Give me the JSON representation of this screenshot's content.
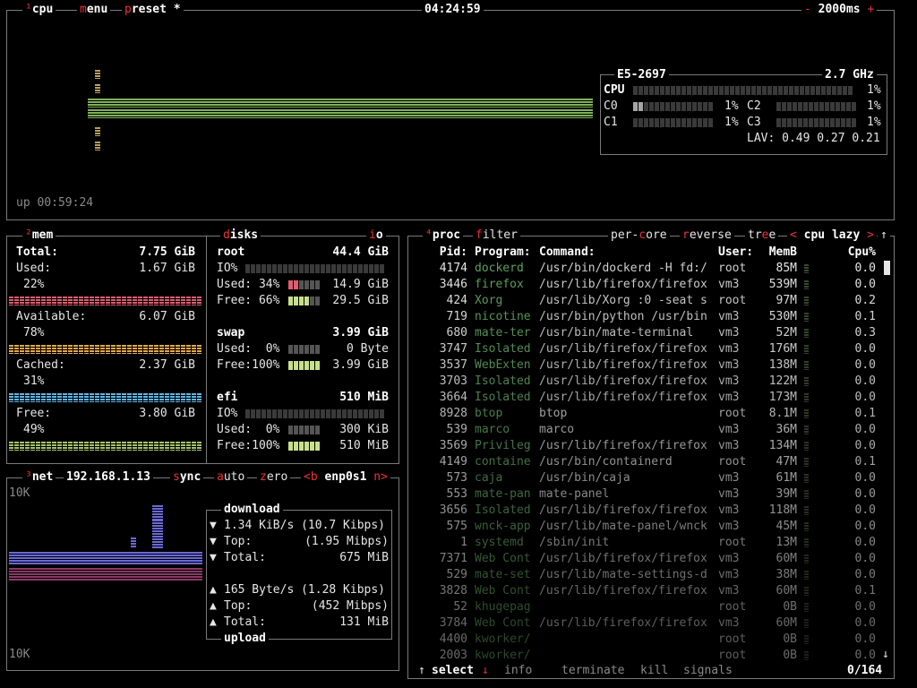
{
  "cpu_box": {
    "num": "¹",
    "title": "cpu",
    "menu": "menu",
    "preset": "preset *",
    "clock": "04:24:59",
    "rate_minus": "-",
    "rate": "2000ms",
    "rate_plus": "+",
    "uptime": "up 00:59:24",
    "model": "E5-2697",
    "freq": "2.7 GHz",
    "total": {
      "label": "CPU",
      "pct": "1%",
      "value": 0.01
    },
    "cores": [
      {
        "label": "C0",
        "pct": "1%",
        "value": 0.1
      },
      {
        "label": "C1",
        "pct": "1%",
        "value": 0.01
      },
      {
        "label": "C2",
        "pct": "1%",
        "value": 0.01
      },
      {
        "label": "C3",
        "pct": "1%",
        "value": 0.01
      }
    ],
    "lav": "LAV: 0.49 0.27 0.21"
  },
  "mem_box": {
    "num": "²",
    "title": "mem",
    "total_label": "Total:",
    "total_val": "7.75 GiB",
    "items": [
      {
        "label": "Used:",
        "val": "1.67 GiB",
        "pct": "22%",
        "color": "#e05d6f"
      },
      {
        "label": "Available:",
        "val": "6.07 GiB",
        "pct": "78%",
        "color": "#e6a84a"
      },
      {
        "label": "Cached:",
        "val": "2.37 GiB",
        "pct": "31%",
        "color": "#5db7e8"
      },
      {
        "label": "Free:",
        "val": "3.80 GiB",
        "pct": "49%",
        "color": "#a6c46b"
      }
    ]
  },
  "disks_box": {
    "title": "disks",
    "io": "io",
    "disks": [
      {
        "name": "root",
        "size": "44.4 GiB",
        "io": "IO%",
        "used_label": "Used: 34%",
        "used_val": "14.9 GiB",
        "free_label": "Free: 66%",
        "free_val": "29.5 GiB",
        "used": 0.34
      },
      {
        "name": "swap",
        "size": "3.99 GiB",
        "io": "",
        "used_label": "Used:  0%",
        "used_val": "0 Byte",
        "free_label": "Free:100%",
        "free_val": "3.99 GiB",
        "used": 0.0
      },
      {
        "name": "efi",
        "size": "510 MiB",
        "io": "IO%",
        "used_label": "Used:  0%",
        "used_val": "300 KiB",
        "free_label": "Free:100%",
        "free_val": "510 MiB",
        "used": 0.0
      }
    ]
  },
  "net_box": {
    "num": "³",
    "title": "net",
    "ip": "192.168.1.13",
    "sync": "sync",
    "auto": "auto",
    "zero": "zero",
    "prev": "<b",
    "iface": "enp0s1",
    "next": "n>",
    "scale_top": "10K",
    "scale_bottom": "10K",
    "download": {
      "title": "download",
      "rate": "1.34 KiB/s (10.7 Kibps)",
      "top_label": "Top:",
      "top": "(1.95 Mibps)",
      "total_label": "Total:",
      "total": "675 MiB"
    },
    "upload": {
      "title": "upload",
      "rate": "165 Byte/s (1.28 Kibps)",
      "top_label": "Top:",
      "top": "(452 Mibps)",
      "total_label": "Total:",
      "total": "131 MiB"
    }
  },
  "proc_box": {
    "num": "⁴",
    "title": "proc",
    "filter": "filter",
    "per_core": "per-core",
    "reverse": "reverse",
    "tree": "tree",
    "sort_prev": "<",
    "sort": "cpu lazy",
    "sort_next": ">",
    "headers": {
      "pid": "Pid:",
      "program": "Program:",
      "command": "Command:",
      "user": "User:",
      "mem": "MemB",
      "cpu": "Cpu%"
    },
    "rows": [
      {
        "pid": "4174",
        "program": "dockerd",
        "command": "/usr/bin/dockerd -H fd:/",
        "user": "root",
        "mem": "85M",
        "cpu": "0.0"
      },
      {
        "pid": "3446",
        "program": "firefox",
        "command": "/usr/lib/firefox/firefox",
        "user": "vm3",
        "mem": "539M",
        "cpu": "0.0"
      },
      {
        "pid": "424",
        "program": "Xorg",
        "command": "/usr/lib/Xorg :0 -seat s",
        "user": "root",
        "mem": "97M",
        "cpu": "0.2"
      },
      {
        "pid": "719",
        "program": "nicotine",
        "command": "/usr/bin/python /usr/bin",
        "user": "vm3",
        "mem": "530M",
        "cpu": "0.1"
      },
      {
        "pid": "680",
        "program": "mate-ter",
        "command": "/usr/bin/mate-terminal",
        "user": "vm3",
        "mem": "52M",
        "cpu": "0.3"
      },
      {
        "pid": "3747",
        "program": "Isolated",
        "command": "/usr/lib/firefox/firefox",
        "user": "vm3",
        "mem": "176M",
        "cpu": "0.0"
      },
      {
        "pid": "3537",
        "program": "WebExten",
        "command": "/usr/lib/firefox/firefox",
        "user": "vm3",
        "mem": "138M",
        "cpu": "0.0"
      },
      {
        "pid": "3703",
        "program": "Isolated",
        "command": "/usr/lib/firefox/firefox",
        "user": "vm3",
        "mem": "122M",
        "cpu": "0.0"
      },
      {
        "pid": "3664",
        "program": "Isolated",
        "command": "/usr/lib/firefox/firefox",
        "user": "vm3",
        "mem": "173M",
        "cpu": "0.0"
      },
      {
        "pid": "8928",
        "program": "btop",
        "command": "btop",
        "user": "root",
        "mem": "8.1M",
        "cpu": "0.1"
      },
      {
        "pid": "539",
        "program": "marco",
        "command": "marco",
        "user": "vm3",
        "mem": "36M",
        "cpu": "0.0"
      },
      {
        "pid": "3569",
        "program": "Privileg",
        "command": "/usr/lib/firefox/firefox",
        "user": "vm3",
        "mem": "134M",
        "cpu": "0.0"
      },
      {
        "pid": "4149",
        "program": "containe",
        "command": "/usr/bin/containerd",
        "user": "root",
        "mem": "47M",
        "cpu": "0.1"
      },
      {
        "pid": "573",
        "program": "caja",
        "command": "/usr/bin/caja",
        "user": "vm3",
        "mem": "61M",
        "cpu": "0.0"
      },
      {
        "pid": "553",
        "program": "mate-pan",
        "command": "mate-panel",
        "user": "vm3",
        "mem": "39M",
        "cpu": "0.0"
      },
      {
        "pid": "3656",
        "program": "Isolated",
        "command": "/usr/lib/firefox/firefox",
        "user": "vm3",
        "mem": "118M",
        "cpu": "0.0"
      },
      {
        "pid": "575",
        "program": "wnck-app",
        "command": "/usr/lib/mate-panel/wnck",
        "user": "vm3",
        "mem": "45M",
        "cpu": "0.0"
      },
      {
        "pid": "1",
        "program": "systemd",
        "command": "/sbin/init",
        "user": "root",
        "mem": "13M",
        "cpu": "0.0"
      },
      {
        "pid": "7371",
        "program": "Web Cont",
        "command": "/usr/lib/firefox/firefox",
        "user": "vm3",
        "mem": "60M",
        "cpu": "0.0"
      },
      {
        "pid": "529",
        "program": "mate-set",
        "command": "/usr/lib/mate-settings-d",
        "user": "vm3",
        "mem": "38M",
        "cpu": "0.0"
      },
      {
        "pid": "3828",
        "program": "Web Cont",
        "command": "/usr/lib/firefox/firefox",
        "user": "vm3",
        "mem": "60M",
        "cpu": "0.1"
      },
      {
        "pid": "52",
        "program": "khugepag",
        "command": "",
        "user": "root",
        "mem": "0B",
        "cpu": "0.0"
      },
      {
        "pid": "3784",
        "program": "Web Cont",
        "command": "/usr/lib/firefox/firefox",
        "user": "vm3",
        "mem": "60M",
        "cpu": "0.0"
      },
      {
        "pid": "4400",
        "program": "kworker/",
        "command": "",
        "user": "root",
        "mem": "0B",
        "cpu": "0.0"
      },
      {
        "pid": "2003",
        "program": "kworker/",
        "command": "",
        "user": "root",
        "mem": "0B",
        "cpu": "0.0"
      }
    ],
    "footer": {
      "up": "↑",
      "select": "select",
      "down": "↓",
      "info": "info",
      "terminate": "terminate",
      "kill": "kill",
      "signals": "signals",
      "count": "0/164"
    }
  },
  "colors": {
    "border": "#7a7a7a",
    "accent_red": "#ee3333",
    "graph_green": "#7fb15a",
    "proc_green": "#5fa05f"
  }
}
